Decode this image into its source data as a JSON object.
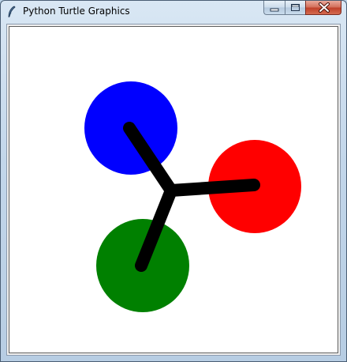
{
  "window": {
    "title": "Python Turtle Graphics",
    "controls": {
      "minimize": "minimize-icon",
      "maximize": "maximize-icon",
      "close": "close-icon"
    }
  },
  "canvas": {
    "background": "#ffffff",
    "shapes": [
      {
        "name": "blue-circle",
        "color": "#0000ff"
      },
      {
        "name": "red-circle",
        "color": "#ff0000"
      },
      {
        "name": "green-circle",
        "color": "#008000"
      }
    ],
    "stroke_color": "#000000"
  }
}
